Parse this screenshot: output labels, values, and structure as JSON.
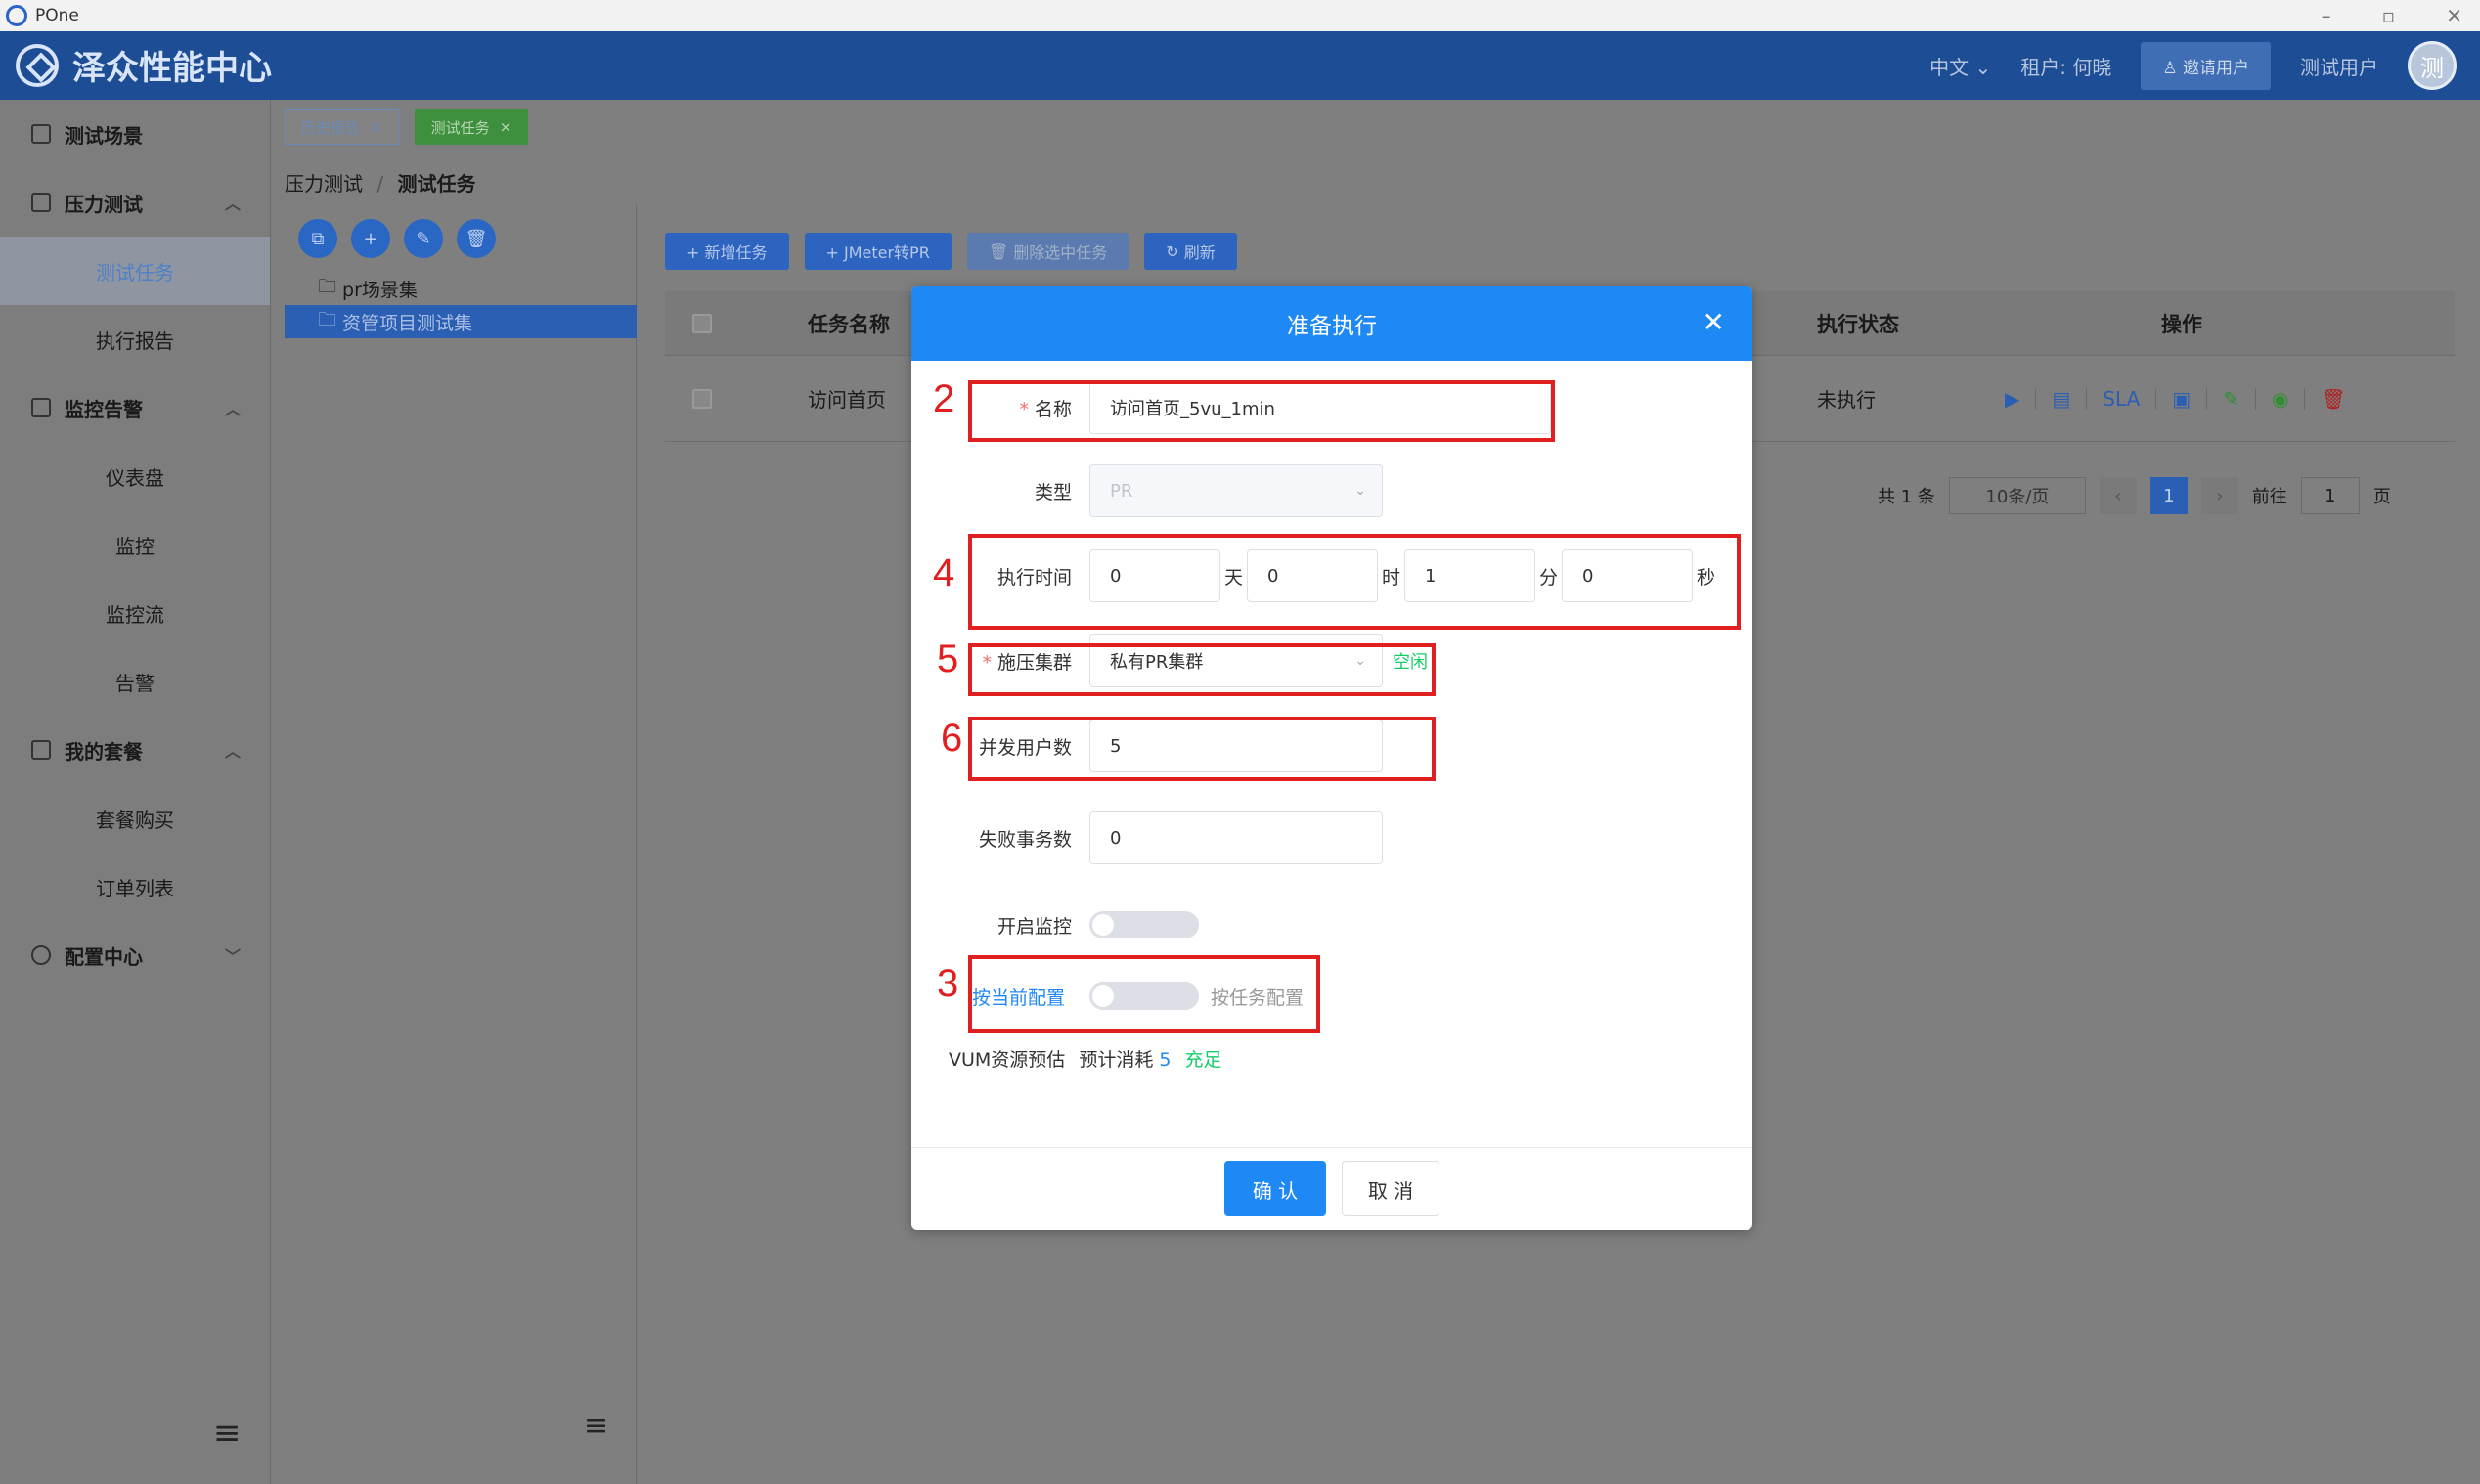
{
  "window": {
    "title": "POne",
    "controls": [
      "–",
      "▫",
      "✕"
    ]
  },
  "header": {
    "brand": "泽众性能中心",
    "language": "中文",
    "tenant": "租户: 何晓",
    "invite_label": "邀请用户",
    "user_name": "测试用户",
    "avatar_text": "测"
  },
  "sidebar": {
    "scene": "测试场景",
    "pressure": "压力测试",
    "pressure_items": [
      "测试任务",
      "执行报告"
    ],
    "monitor": "监控告警",
    "monitor_items": [
      "仪表盘",
      "监控",
      "监控流",
      "告警"
    ],
    "plan": "我的套餐",
    "plan_items": [
      "套餐购买",
      "订单列表"
    ],
    "config": "配置中心"
  },
  "tabs": [
    {
      "label": "历史报告"
    },
    {
      "label": "测试任务"
    }
  ],
  "breadcrumb": {
    "parent": "压力测试",
    "sep": "/",
    "current": "测试任务"
  },
  "tree": {
    "nodes": [
      "pr场景集",
      "资管项目测试集"
    ]
  },
  "toolbar": {
    "add": "+ 新增任务",
    "convert": "+ JMeter转PR",
    "delete": "删除选中任务",
    "refresh": "刷新"
  },
  "table": {
    "headers": {
      "name": "任务名称",
      "status": "执行状态",
      "ops": "操作"
    },
    "row": {
      "name": "访问首页",
      "status": "未执行",
      "sla": "SLA"
    }
  },
  "pager": {
    "total": "共 1 条",
    "size": "10条/页",
    "page": "1",
    "goto": "前往",
    "goto_value": "1",
    "unit": "页"
  },
  "modal": {
    "title": "准备执行",
    "name_label": "名称",
    "name_value": "访问首页_5vu_1min",
    "type_label": "类型",
    "type_value": "PR",
    "time_label": "执行时间",
    "days": "0",
    "days_unit": "天",
    "hours": "0",
    "hours_unit": "时",
    "minutes": "1",
    "minutes_unit": "分",
    "seconds": "0",
    "seconds_unit": "秒",
    "cluster_label": "施压集群",
    "cluster_value": "私有PR集群",
    "cluster_status": "空闲",
    "users_label": "并发用户数",
    "users_value": "5",
    "fail_label": "失败事务数",
    "fail_value": "0",
    "monitor_label": "开启监控",
    "config_label": "按当前配置",
    "config_alt": "按任务配置",
    "vum_label": "VUM资源预估",
    "vum_text": "预计消耗",
    "vum_value": "5",
    "vum_status": "充足",
    "confirm": "确 认",
    "cancel": "取 消"
  },
  "annotations": [
    "2",
    "4",
    "5",
    "6",
    "3"
  ],
  "colors": {
    "accent": "#1e88f5",
    "annotation": "#e02020",
    "brand_bar": "#1d4d95",
    "idle": "#13ce66"
  }
}
